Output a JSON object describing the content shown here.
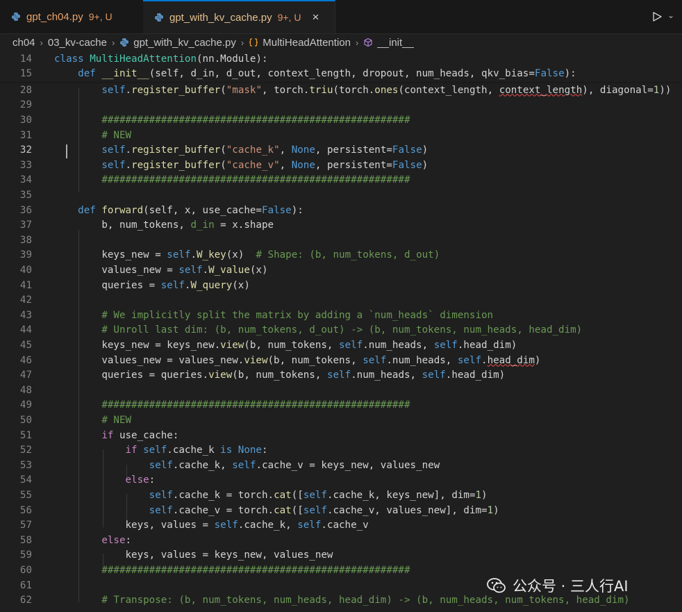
{
  "tabs": [
    {
      "name": "gpt_ch04.py",
      "badge": "9+, U",
      "active": false
    },
    {
      "name": "gpt_with_kv_cache.py",
      "badge": "9+, U",
      "active": true,
      "close": "×"
    }
  ],
  "breadcrumb": [
    "ch04",
    "03_kv-cache",
    "gpt_with_kv_cache.py",
    "MultiHeadAttention",
    "__init__"
  ],
  "run_dropdown": "⌄",
  "watermark": "公众号 · 三人行AI",
  "lines": [
    {
      "n": "14",
      "code": [
        [
          "k",
          "class "
        ],
        [
          "cls",
          "MultiHeadAttention"
        ],
        [
          "",
          "(nn.Module):"
        ]
      ]
    },
    {
      "n": "15",
      "code": [
        [
          "",
          "    "
        ],
        [
          "k",
          "def "
        ],
        [
          "f",
          "__init__"
        ],
        [
          "",
          "(self, d_in, d_out, context_length, dropout, num_heads, qkv_bias="
        ],
        [
          "k",
          "False"
        ],
        [
          "",
          "):"
        ]
      ]
    },
    {
      "n": "28",
      "code": [
        [
          "",
          "        "
        ],
        [
          "k",
          "self"
        ],
        [
          "",
          "."
        ],
        [
          "f",
          "register_buffer"
        ],
        [
          "",
          "("
        ],
        [
          "s",
          "\"mask\""
        ],
        [
          "",
          ", torch."
        ],
        [
          "f",
          "triu"
        ],
        [
          "",
          "(torch."
        ],
        [
          "f",
          "ones"
        ],
        [
          "",
          "(context_length, "
        ],
        [
          "sq",
          "context_length"
        ],
        [
          "",
          "), diagonal="
        ],
        [
          "n",
          "1"
        ],
        [
          "",
          "))"
        ]
      ]
    },
    {
      "n": "29",
      "code": []
    },
    {
      "n": "30",
      "code": [
        [
          "",
          "        "
        ],
        [
          "c",
          "####################################################"
        ]
      ]
    },
    {
      "n": "31",
      "code": [
        [
          "",
          "        "
        ],
        [
          "c",
          "# NEW"
        ]
      ]
    },
    {
      "n": "32",
      "code": [
        [
          "",
          "        "
        ],
        [
          "k",
          "self"
        ],
        [
          "",
          "."
        ],
        [
          "f",
          "register_buffer"
        ],
        [
          "",
          "("
        ],
        [
          "s",
          "\"cache_k\""
        ],
        [
          "",
          ", "
        ],
        [
          "k",
          "None"
        ],
        [
          "",
          ", persistent="
        ],
        [
          "k",
          "False"
        ],
        [
          "",
          ")"
        ]
      ]
    },
    {
      "n": "33",
      "code": [
        [
          "",
          "        "
        ],
        [
          "k",
          "self"
        ],
        [
          "",
          "."
        ],
        [
          "f",
          "register_buffer"
        ],
        [
          "",
          "("
        ],
        [
          "s",
          "\"cache_v\""
        ],
        [
          "",
          ", "
        ],
        [
          "k",
          "None"
        ],
        [
          "",
          ", persistent="
        ],
        [
          "k",
          "False"
        ],
        [
          "",
          ")"
        ]
      ]
    },
    {
      "n": "34",
      "code": [
        [
          "",
          "        "
        ],
        [
          "c",
          "####################################################"
        ]
      ]
    },
    {
      "n": "35",
      "code": []
    },
    {
      "n": "36",
      "code": [
        [
          "",
          "    "
        ],
        [
          "k",
          "def "
        ],
        [
          "f",
          "forward"
        ],
        [
          "",
          "(self, x, use_cache="
        ],
        [
          "k",
          "False"
        ],
        [
          "",
          "):"
        ]
      ]
    },
    {
      "n": "37",
      "code": [
        [
          "",
          "        b, num_tokens, "
        ],
        [
          "c",
          "d_in"
        ],
        [
          "",
          " = x.shape"
        ]
      ]
    },
    {
      "n": "38",
      "code": []
    },
    {
      "n": "39",
      "code": [
        [
          "",
          "        keys_new = "
        ],
        [
          "k",
          "self"
        ],
        [
          "",
          "."
        ],
        [
          "f",
          "W_key"
        ],
        [
          "",
          "(x)  "
        ],
        [
          "c",
          "# Shape: (b, num_tokens, d_out)"
        ]
      ]
    },
    {
      "n": "40",
      "code": [
        [
          "",
          "        values_new = "
        ],
        [
          "k",
          "self"
        ],
        [
          "",
          "."
        ],
        [
          "f",
          "W_value"
        ],
        [
          "",
          "(x)"
        ]
      ]
    },
    {
      "n": "41",
      "code": [
        [
          "",
          "        queries = "
        ],
        [
          "k",
          "self"
        ],
        [
          "",
          "."
        ],
        [
          "f",
          "W_query"
        ],
        [
          "",
          "(x)"
        ]
      ]
    },
    {
      "n": "42",
      "code": []
    },
    {
      "n": "43",
      "code": [
        [
          "",
          "        "
        ],
        [
          "c",
          "# We implicitly split the matrix by adding a `num_heads` dimension"
        ]
      ]
    },
    {
      "n": "44",
      "code": [
        [
          "",
          "        "
        ],
        [
          "c",
          "# Unroll last dim: (b, num_tokens, d_out) -> (b, num_tokens, num_heads, head_dim)"
        ]
      ]
    },
    {
      "n": "45",
      "code": [
        [
          "",
          "        keys_new = keys_new."
        ],
        [
          "f",
          "view"
        ],
        [
          "",
          "(b, num_tokens, "
        ],
        [
          "k",
          "self"
        ],
        [
          "",
          ".num_heads, "
        ],
        [
          "k",
          "self"
        ],
        [
          "",
          ".head_dim)"
        ]
      ]
    },
    {
      "n": "46",
      "code": [
        [
          "",
          "        values_new = values_new."
        ],
        [
          "f",
          "view"
        ],
        [
          "",
          "(b, num_tokens, "
        ],
        [
          "k",
          "self"
        ],
        [
          "",
          ".num_heads, "
        ],
        [
          "k",
          "self"
        ],
        [
          "",
          "."
        ],
        [
          "sq",
          "head_dim"
        ],
        [
          "",
          ")"
        ]
      ]
    },
    {
      "n": "47",
      "code": [
        [
          "",
          "        queries = queries."
        ],
        [
          "f",
          "view"
        ],
        [
          "",
          "(b, num_tokens, "
        ],
        [
          "k",
          "self"
        ],
        [
          "",
          ".num_heads, "
        ],
        [
          "k",
          "self"
        ],
        [
          "",
          ".head_dim)"
        ]
      ]
    },
    {
      "n": "48",
      "code": []
    },
    {
      "n": "49",
      "code": [
        [
          "",
          "        "
        ],
        [
          "c",
          "####################################################"
        ]
      ]
    },
    {
      "n": "50",
      "code": [
        [
          "",
          "        "
        ],
        [
          "c",
          "# NEW"
        ]
      ]
    },
    {
      "n": "51",
      "code": [
        [
          "",
          "        "
        ],
        [
          "kc",
          "if"
        ],
        [
          "",
          " use_cache:"
        ]
      ]
    },
    {
      "n": "52",
      "code": [
        [
          "",
          "            "
        ],
        [
          "kc",
          "if "
        ],
        [
          "k",
          "self"
        ],
        [
          "",
          ".cache_k "
        ],
        [
          "k",
          "is None"
        ],
        [
          "",
          ":"
        ]
      ]
    },
    {
      "n": "53",
      "code": [
        [
          "",
          "                "
        ],
        [
          "k",
          "self"
        ],
        [
          "",
          ".cache_k, "
        ],
        [
          "k",
          "self"
        ],
        [
          "",
          ".cache_v = keys_new, values_new"
        ]
      ]
    },
    {
      "n": "54",
      "code": [
        [
          "",
          "            "
        ],
        [
          "kc",
          "else"
        ],
        [
          "",
          ":"
        ]
      ]
    },
    {
      "n": "55",
      "code": [
        [
          "",
          "                "
        ],
        [
          "k",
          "self"
        ],
        [
          "",
          ".cache_k = torch."
        ],
        [
          "f",
          "cat"
        ],
        [
          "",
          "(["
        ],
        [
          "k",
          "self"
        ],
        [
          "",
          ".cache_k, keys_new], dim="
        ],
        [
          "n",
          "1"
        ],
        [
          "",
          ")"
        ]
      ]
    },
    {
      "n": "56",
      "code": [
        [
          "",
          "                "
        ],
        [
          "k",
          "self"
        ],
        [
          "",
          ".cache_v = torch."
        ],
        [
          "f",
          "cat"
        ],
        [
          "",
          "(["
        ],
        [
          "k",
          "self"
        ],
        [
          "",
          ".cache_v, values_new], dim="
        ],
        [
          "n",
          "1"
        ],
        [
          "",
          ")"
        ]
      ]
    },
    {
      "n": "57",
      "code": [
        [
          "",
          "            keys, values = "
        ],
        [
          "k",
          "self"
        ],
        [
          "",
          ".cache_k, "
        ],
        [
          "k",
          "self"
        ],
        [
          "",
          ".cache_v"
        ]
      ]
    },
    {
      "n": "58",
      "code": [
        [
          "",
          "        "
        ],
        [
          "kc",
          "else"
        ],
        [
          "",
          ":"
        ]
      ]
    },
    {
      "n": "59",
      "code": [
        [
          "",
          "            keys, values = keys_new, values_new"
        ]
      ]
    },
    {
      "n": "60",
      "code": [
        [
          "",
          "        "
        ],
        [
          "c",
          "####################################################"
        ]
      ]
    },
    {
      "n": "61",
      "code": []
    },
    {
      "n": "62",
      "code": [
        [
          "",
          "        "
        ],
        [
          "c",
          "# Transpose: (b, num_tokens, num_heads, head_dim) -> (b, num_heads, num_tokens, head_dim)"
        ]
      ]
    }
  ],
  "active_line": "32"
}
